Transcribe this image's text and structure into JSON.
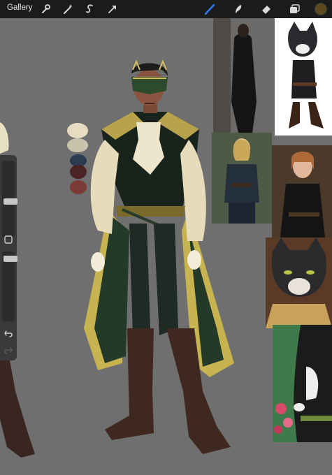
{
  "toolbar": {
    "gallery_label": "Gallery",
    "icons": [
      "wrench-icon",
      "magic-wand-icon",
      "selection-icon",
      "transform-arrow-icon",
      "brush-icon",
      "smudge-icon",
      "eraser-icon",
      "layers-icon"
    ],
    "active_tool": "brush-icon",
    "accent_color": "#2f7cf6",
    "current_color": "#5a4a1e"
  },
  "sidebar": {
    "size_slider_level": 0.35,
    "opacity_slider_level": 0.15,
    "buttons": [
      "modify-square-icon",
      "undo-icon",
      "redo-icon"
    ]
  },
  "palette": {
    "colors": [
      "#e6dcc2",
      "#2b3b52",
      "#4a2326",
      "#7a3b35"
    ]
  },
  "references": [
    "black-coat-outfit-photo",
    "cartoon-cat-in-boots",
    "woman-in-leather-vest-photo",
    "woman-in-black-blouse-photo",
    "cartoon-cat-closeup",
    "cartoon-cat-in-garden"
  ]
}
